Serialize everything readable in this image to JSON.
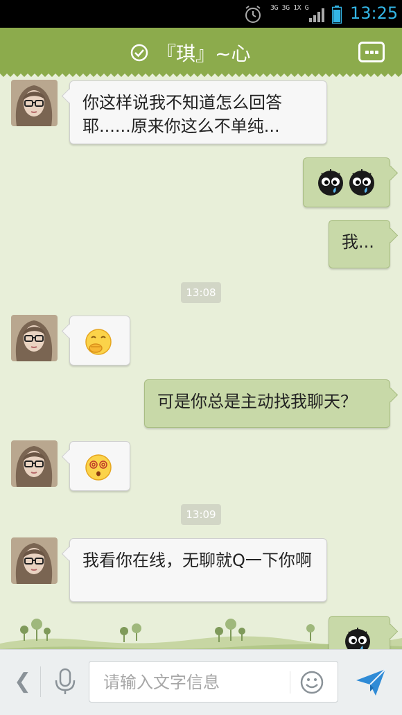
{
  "status_bar": {
    "network_label": "3G 3G 1X G",
    "time": "13:25",
    "icons": [
      "alarm-icon",
      "signal-icon",
      "battery-icon"
    ],
    "time_color": "#33b5e5"
  },
  "header": {
    "title": "『琪』~心",
    "icons": [
      "verified-check-icon",
      "more-menu-icon"
    ],
    "bg_color": "#8cab4c"
  },
  "messages": [
    {
      "side": "left",
      "type": "text",
      "text": "你这样说我不知道怎么回答耶......原来你这么不单纯..."
    },
    {
      "side": "right",
      "type": "emoji",
      "icons": [
        "crying-black-ball-emoji",
        "crying-black-ball-emoji"
      ]
    },
    {
      "side": "right",
      "type": "text",
      "text": "我..."
    },
    {
      "type": "timestamp",
      "text": "13:08"
    },
    {
      "side": "left",
      "type": "emoji",
      "icons": [
        "laughing-covering-mouth-emoji"
      ]
    },
    {
      "side": "right",
      "type": "text",
      "text": "可是你总是主动找我聊天？"
    },
    {
      "side": "left",
      "type": "emoji",
      "icons": [
        "dizzy-face-emoji"
      ]
    },
    {
      "type": "timestamp",
      "text": "13:09"
    },
    {
      "side": "left",
      "type": "text",
      "text": "我看你在线，无聊就Q一下你啊"
    },
    {
      "side": "right",
      "type": "emoji",
      "icons": [
        "crying-black-ball-emoji"
      ]
    }
  ],
  "input_bar": {
    "placeholder": "请输入文字信息",
    "icons": [
      "back-chevron-icon",
      "microphone-icon",
      "smiley-icon",
      "send-icon"
    ]
  },
  "colors": {
    "chat_bg": "#e8efd9",
    "left_bubble": "#f7f7f7",
    "right_bubble": "#c8d9a8",
    "send_icon": "#2f8bd6"
  }
}
